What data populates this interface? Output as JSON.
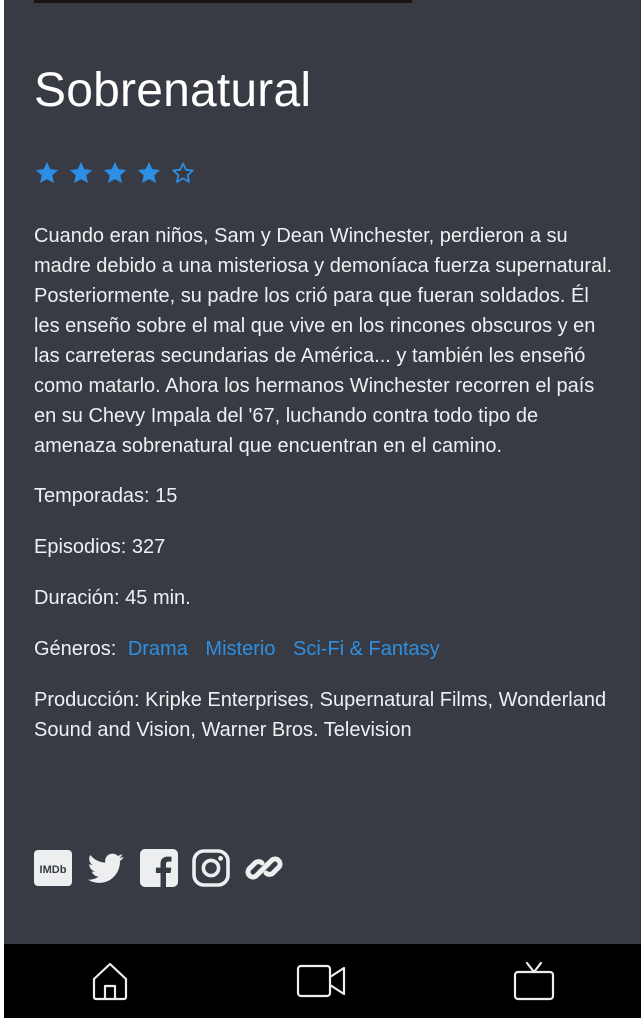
{
  "show": {
    "title": "Sobrenatural",
    "rating": {
      "value": 4,
      "max": 5
    },
    "description": "Cuando eran niños, Sam y Dean Winchester, perdieron a su madre debido a una misteriosa y demoníaca fuerza supernatural. Posteriormente, su padre los crió para que fueran soldados. Él les enseño sobre el mal que vive en los rincones obscuros y en las carreteras secundarias de América... y también les enseñó como matarlo. Ahora los hermanos Winchester recorren el país en su Chevy Impala del '67, luchando contra todo tipo de amenaza sobrenatural que encuentran en el camino.",
    "seasons": "Temporadas: 15",
    "episodes": "Episodios: 327",
    "duration": "Duración: 45 min.",
    "genres_label": "Géneros:",
    "genres": [
      "Drama",
      "Misterio",
      "Sci-Fi & Fantasy"
    ],
    "production": "Producción: Kripke Enterprises, Supernatural Films, Wonderland Sound and Vision, Warner Bros. Television"
  },
  "social": {
    "imdb_label": "IMDb",
    "icons": [
      "imdb-icon",
      "twitter-icon",
      "facebook-icon",
      "instagram-icon",
      "link-icon"
    ]
  },
  "nav": {
    "icons": [
      "home-icon",
      "video-camera-icon",
      "tv-icon"
    ]
  },
  "colors": {
    "background": "#383b43",
    "accent": "#2f8fe0",
    "star": "#2b8fe6",
    "text": "#eef0f2",
    "nav_background": "#000000"
  }
}
